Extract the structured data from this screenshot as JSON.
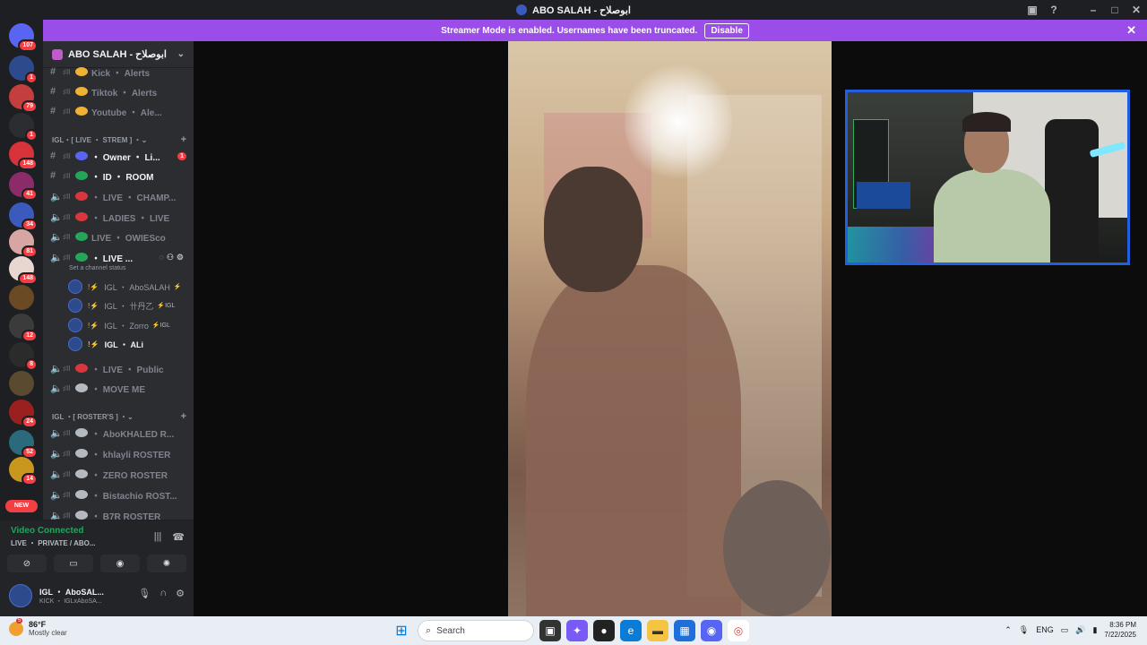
{
  "window": {
    "title": "ABO SALAH - ابوصلاح"
  },
  "banner": {
    "message": "Streamer Mode is enabled. Usernames have been truncated.",
    "button": "Disable"
  },
  "rail": {
    "servers": [
      {
        "badge": "107",
        "color": "#5865f2"
      },
      {
        "badge": "1",
        "color": "#2c4a8c"
      },
      {
        "badge": "79",
        "color": "#c43e3e"
      },
      {
        "badge": "1",
        "color": "#2b2d31"
      },
      {
        "badge": "148",
        "color": "#d8323a"
      },
      {
        "badge": "41",
        "color": "#8c2b6a"
      },
      {
        "badge": "34",
        "color": "#3a5bbd"
      },
      {
        "badge": "81",
        "color": "#d7a6a2"
      },
      {
        "badge": "148",
        "color": "#e8d6d0"
      },
      {
        "badge": "",
        "color": "#6a4a24"
      },
      {
        "badge": "12",
        "color": "#3b3b3b"
      },
      {
        "badge": "8",
        "color": "#2b2b2b"
      },
      {
        "badge": "",
        "color": "#5a4a30"
      },
      {
        "badge": "24",
        "color": "#9a2020"
      },
      {
        "badge": "52",
        "color": "#2a6a7a"
      },
      {
        "badge": "14",
        "color": "#c9961e"
      }
    ],
    "new_label": "NEW"
  },
  "server": {
    "name": "ABO SALAH - ابوصلاح"
  },
  "channels_top": [
    {
      "name": "Kick ・ Alerts"
    },
    {
      "name": "Tiktok ・ Alerts"
    },
    {
      "name": "Youtube ・ Ale..."
    }
  ],
  "category_live": {
    "name": "IGL・[ LIVE ・ STREM ] ・"
  },
  "channels_live": [
    {
      "name": "・ Owner ・ Li...",
      "badge": "1",
      "dot": "#5865f2"
    },
    {
      "name": "・ ID ・ ROOM",
      "badge": "",
      "dot": "#23a55a"
    },
    {
      "name": "・ LIVE ・ CHAMP...",
      "badge": "",
      "dot": "#da373c"
    },
    {
      "name": "・ LADIES ・ LIVE",
      "badge": "",
      "dot": "#da373c"
    },
    {
      "name": "LIVE ・ OWIESco",
      "badge": "",
      "dot": "#23a55a"
    },
    {
      "name": "・ LIVE ...",
      "badge": "",
      "dot": "#23a55a"
    }
  ],
  "channel_status": "Set a channel status",
  "voice_users": [
    {
      "name": "IGL ・ AboSALAH",
      "tag": "⚡"
    },
    {
      "name": "IGL ・ 卄丹乙",
      "tag": "⚡IGL"
    },
    {
      "name": "IGL ・ Zorro",
      "tag": "⚡IGL"
    },
    {
      "name": "IGL ・ ALi",
      "tag": ""
    }
  ],
  "channels_after": [
    {
      "name": "・ LIVE ・ Public"
    },
    {
      "name": "・ MOVE ME"
    }
  ],
  "category_roster": {
    "name": "IGL ・[ ROSTER'S ] ・"
  },
  "channels_roster": [
    {
      "name": "・ AboKHALED R..."
    },
    {
      "name": "・ khlayli ROSTER"
    },
    {
      "name": "・ ZERO ROSTER"
    },
    {
      "name": "・ Bistachio ROST..."
    },
    {
      "name": "・ B7R ROSTER"
    }
  ],
  "voice_panel": {
    "status": "Video Connected",
    "channel": "LIVE ・ PRIVATE / ABO..."
  },
  "user_panel": {
    "name": "IGL ・ AboSAL...",
    "sub": "KICK ・ IGLxAboSA..."
  },
  "taskbar": {
    "weather_temp": "86°F",
    "weather_desc": "Mostly clear",
    "weather_alert": "5",
    "search_placeholder": "Search",
    "lang": "ENG",
    "time": "8:36 PM",
    "date": "7/22/2025"
  },
  "colors": {
    "accent": "#9b4dea",
    "pip_border": "#1f5fe0",
    "connected": "#23a55a"
  }
}
